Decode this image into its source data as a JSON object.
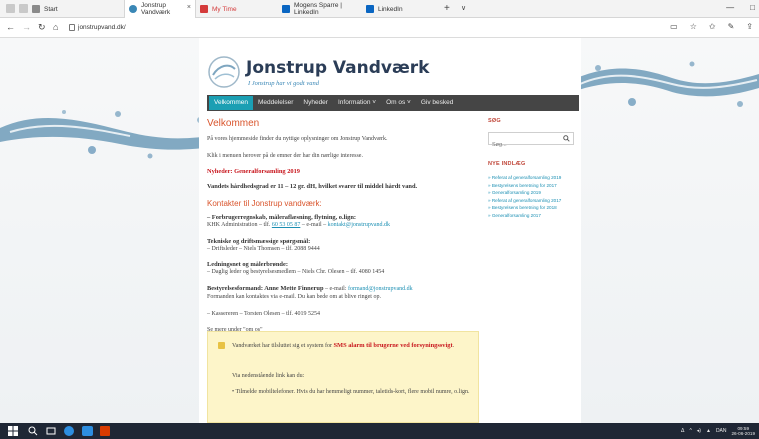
{
  "browser": {
    "tabs": [
      {
        "label": "Start"
      },
      {
        "label": "Jonstrup Vandværk",
        "active": true
      },
      {
        "label": "My Time"
      },
      {
        "label": "Mogens Sparre | LinkedIn"
      },
      {
        "label": "LinkedIn"
      }
    ],
    "url": "jonstrupvand.dk/",
    "new_tab": "+",
    "tab_dropdown": "∨",
    "window_controls": [
      "—",
      "□"
    ]
  },
  "site": {
    "title": "Jonstrup Vandværk",
    "tagline": "I Jonstrup har vi godt vand",
    "menu": [
      {
        "label": "Velkommen",
        "active": true
      },
      {
        "label": "Meddelelser"
      },
      {
        "label": "Nyheder"
      },
      {
        "label": "Information ˅"
      },
      {
        "label": "Om os ˅"
      },
      {
        "label": "Giv besked"
      }
    ]
  },
  "main": {
    "heading": "Velkommen",
    "intro": "På vores hjemmeside finder du nyttige oplysninger om Jonstrup Vandværk.",
    "instruction": "Klik i menuen herover på de emner der har din nærlige interesse.",
    "news_link": "Nyheder: Generalforsamling 2019",
    "hardness": "Vandets hårdhedsgrad er 11 – 12 gr. dH, hvilket svarer til middel hårdt vand.",
    "contact_heading": "Kontakter til Jonstrup vandværk:",
    "contacts": [
      {
        "title": "– Forbrugerregnskab, måleraflæsning, flytning, o.lign:",
        "line_prefix": "KHK Administration – tlf. ",
        "phone": "60 53 05 87",
        "line_mid": " – e-mail – ",
        "email": "kontakt@jonstrupvand.dk"
      },
      {
        "title": "Tekniske og driftsmæssige spørgsmål:",
        "line": "– Driftsleder – Niels Thomsen – tlf. 2088 9444"
      },
      {
        "title": "Ledningsnet og målerbrønde:",
        "line": "– Daglig leder og bestyrelsesmedlem – Niels Chr. Olesen – tlf. 4080 1454"
      },
      {
        "title": "Bestyrelsesformand: Anne Mette Finnerup",
        "title_suffix": " – e-mail: ",
        "email": "formand@jonstrupvand.dk",
        "line": "Formanden kan kontaktes via e-mail. Du kan bede om at blive ringet op."
      }
    ],
    "treasurer": "– Kassereren – Torsten Olesen – tlf. 4019 5254",
    "see_more": "Se mere under \"om os\""
  },
  "notice": {
    "text_prefix": "Vandværket har tilsluttet sig et system for ",
    "text_highlight": "SMS alarm til brugerne ved forsyningssvigt",
    "text_suffix": ".",
    "link_intro": "Via nedenstående link kan du:",
    "bullet": "Tilmelde mobiltelefoner. Hvis du har hemmeligt nummer, taletids-kort, flere mobil numre, o.lign."
  },
  "sidebar": {
    "search_heading": "SØG",
    "search_placeholder": "Søg...",
    "recent_heading": "NYE INDLÆG",
    "recent_posts": [
      "Referat af generalforsamling 2019",
      "Bestyrelsens beretning for 2017",
      "Generalforsamling 2019",
      "Referat af generalforsamling 2017",
      "Bestyrelsens beretning for 2018",
      "Generalforsamling 2017"
    ]
  },
  "taskbar": {
    "language": "DAN",
    "time": "09:59",
    "date": "26-06-2019"
  },
  "colors": {
    "accent": "#1b9fb3",
    "heading": "#d9552d",
    "red_text": "#c8161d",
    "menu_bg": "#454545",
    "notice_bg": "#fdf5c9",
    "title": "#2b3d57"
  }
}
